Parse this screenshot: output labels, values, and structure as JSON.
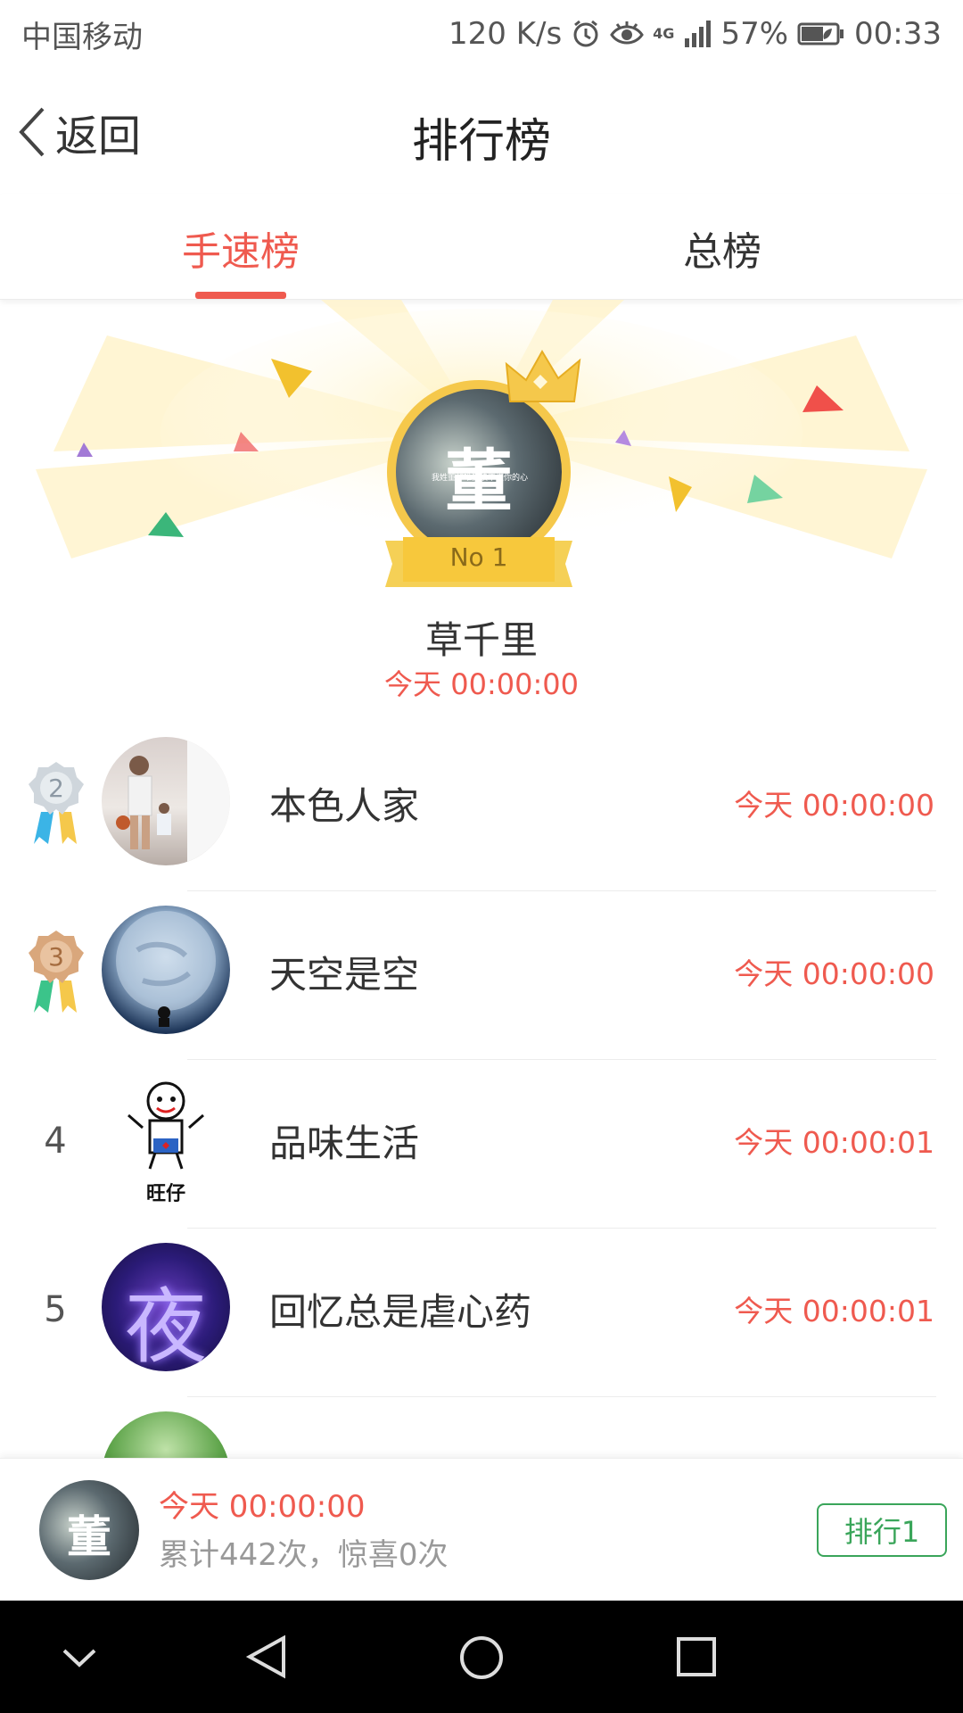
{
  "status_bar": {
    "carrier": "中国移动",
    "speed": "120 K/s",
    "network": "4G",
    "battery": "57%",
    "time": "00:33"
  },
  "nav": {
    "back_label": "返回",
    "title": "排行榜"
  },
  "tabs": [
    {
      "label": "手速榜",
      "active": true
    },
    {
      "label": "总榜",
      "active": false
    }
  ],
  "champion": {
    "badge": "No 1",
    "avatar_char": "董",
    "avatar_caption": "我姓董却唯独读不懂你的心",
    "name": "草千里",
    "time": "今天 00:00:00"
  },
  "rankings": [
    {
      "rank": "2",
      "name": "本色人家",
      "time": "今天 00:00:00",
      "avatar": "basketball-photo"
    },
    {
      "rank": "3",
      "name": "天空是空",
      "time": "今天 00:00:00",
      "avatar": "moon-photo"
    },
    {
      "rank": "4",
      "name": "品味生活",
      "time": "今天 00:00:01",
      "avatar": "wangzai-cartoon",
      "avatar_text": "旺仔"
    },
    {
      "rank": "5",
      "name": "回忆总是虐心药",
      "time": "今天 00:00:01",
      "avatar": "night-character",
      "avatar_text": "夜"
    }
  ],
  "me": {
    "avatar_char": "董",
    "time": "今天 00:00:00",
    "stats": "累计442次，惊喜0次",
    "rank_button": "排行1"
  },
  "colors": {
    "accent": "#ef5a4f",
    "green": "#3aa55a",
    "gold": "#f5c84b"
  }
}
